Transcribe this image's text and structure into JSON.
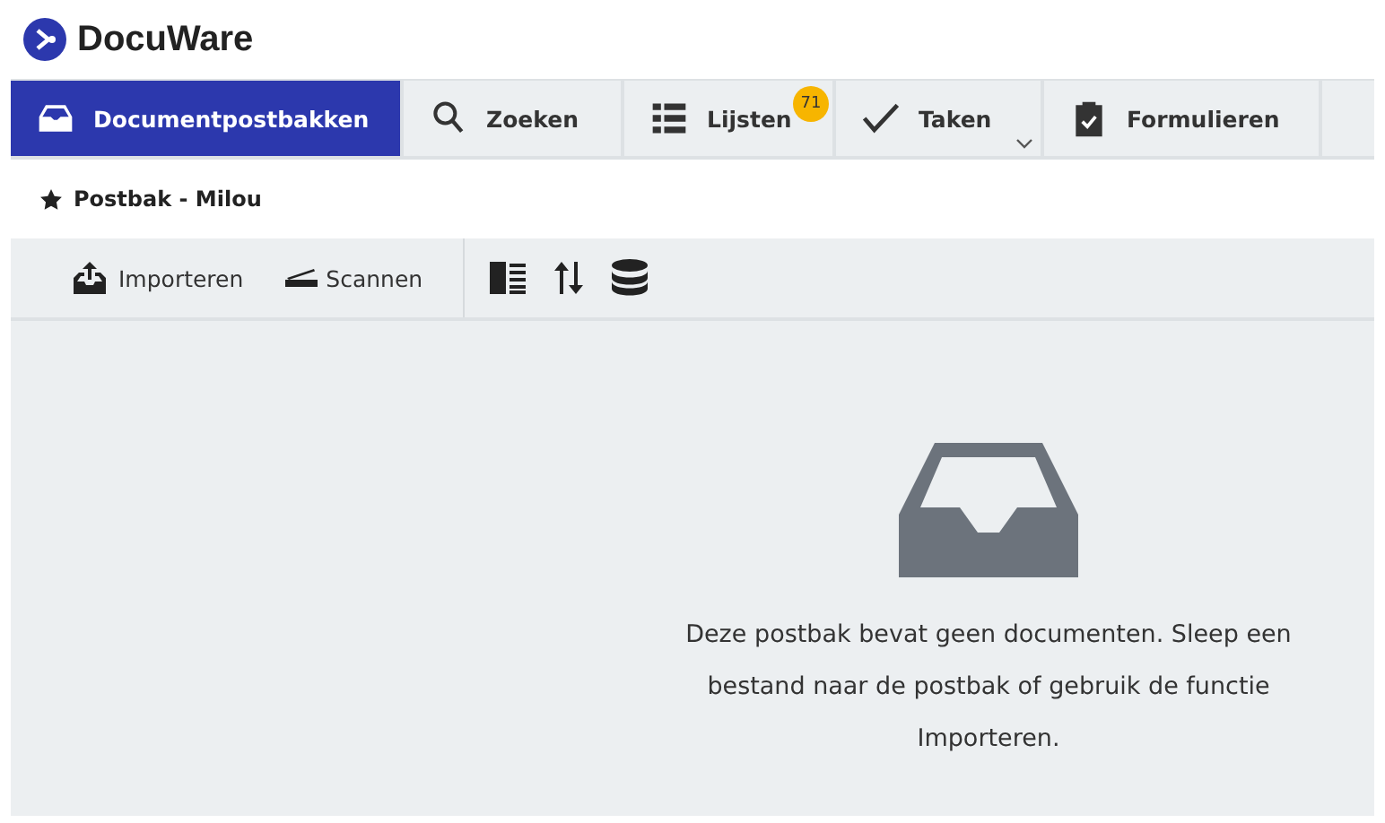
{
  "brand": {
    "name": "DocuWare"
  },
  "tabs": [
    {
      "label": "Documentpostbakken",
      "kind": "tray",
      "selected": true
    },
    {
      "label": "Zoeken",
      "kind": "search",
      "selected": false
    },
    {
      "label": "Lijsten",
      "kind": "list",
      "selected": false,
      "badge": "71"
    },
    {
      "label": "Taken",
      "kind": "check",
      "selected": false,
      "dropdown": true
    },
    {
      "label": "Formulieren",
      "kind": "form",
      "selected": false
    }
  ],
  "breadcrumb": {
    "title": "Postbak - Milou",
    "favorite": true
  },
  "toolbar": [
    {
      "label": "Importeren",
      "kind": "import"
    },
    {
      "label": "Scannen",
      "kind": "scan"
    },
    {
      "kind": "panel"
    },
    {
      "kind": "sort"
    },
    {
      "kind": "database"
    }
  ],
  "empty_message": "Deze postbak bevat geen documenten. Sleep een bestand naar de postbak of gebruik de functie Importeren."
}
